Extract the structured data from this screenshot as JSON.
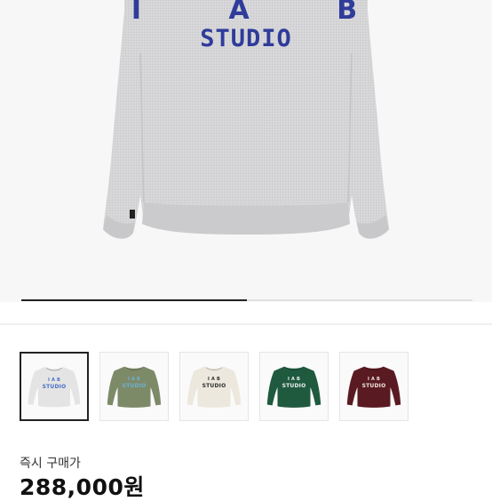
{
  "hero": {
    "image_icon": "sweatshirt-image",
    "print_top": "I A B",
    "print_main": "STUDIO",
    "progress": 0.5
  },
  "thumbnails": [
    {
      "color_name": "grey",
      "body": "#e4e4e4",
      "text_color": "#4a6fc8",
      "selected": true
    },
    {
      "color_name": "khaki",
      "body": "#7d8a68",
      "text_color": "#6fb0d8",
      "selected": false
    },
    {
      "color_name": "cream",
      "body": "#ece8de",
      "text_color": "#2d2d2d",
      "selected": false
    },
    {
      "color_name": "green",
      "body": "#1f5a3f",
      "text_color": "#f0f0f0",
      "selected": false
    },
    {
      "color_name": "burgundy",
      "body": "#5a1a22",
      "text_color": "#f0e8e0",
      "selected": false
    }
  ],
  "price": {
    "caption": "즉시 구매가",
    "value": "288,000원"
  },
  "colors": {
    "print_blue": "#2f3c9a",
    "heather_grey": "#d6d6d8"
  }
}
